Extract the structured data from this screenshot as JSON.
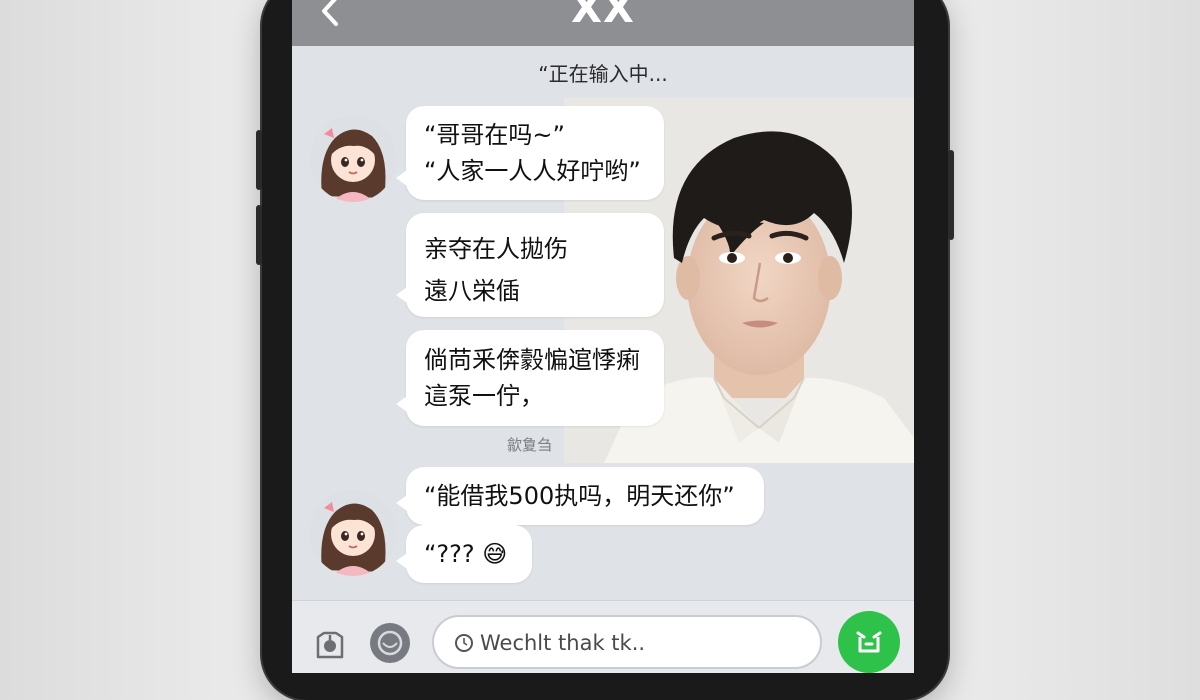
{
  "chat": {
    "title": "XX",
    "status_text": "“正在输入中..."
  },
  "messages": [
    {
      "lines": [
        "“哥哥在吗~”",
        "“人家一人人好咛哟”"
      ]
    },
    {
      "lines": [
        "亲夺在人拋伤",
        "遠八栄偛"
      ]
    },
    {
      "lines": [
        "倘苘釆倴豰惼逭悸痢",
        "這泵一佇，"
      ]
    },
    {
      "lines": [
        "“能借我500执吗，明天还你”"
      ]
    },
    {
      "lines": [
        "“???"
      ],
      "emoji": "😅"
    }
  ],
  "timestamp": "歙夐刍",
  "input": {
    "placeholder": "Wechlt thak tk.."
  },
  "colors": {
    "nav_bar": "#8d8f93",
    "chat_background": "#dfe2e7",
    "bubble": "#ffffff",
    "send_button": "#2fc24a"
  },
  "icons": {
    "back": "chevron-left-icon",
    "voice": "voice-icon",
    "sticker": "sticker-icon",
    "send": "send-icon"
  }
}
